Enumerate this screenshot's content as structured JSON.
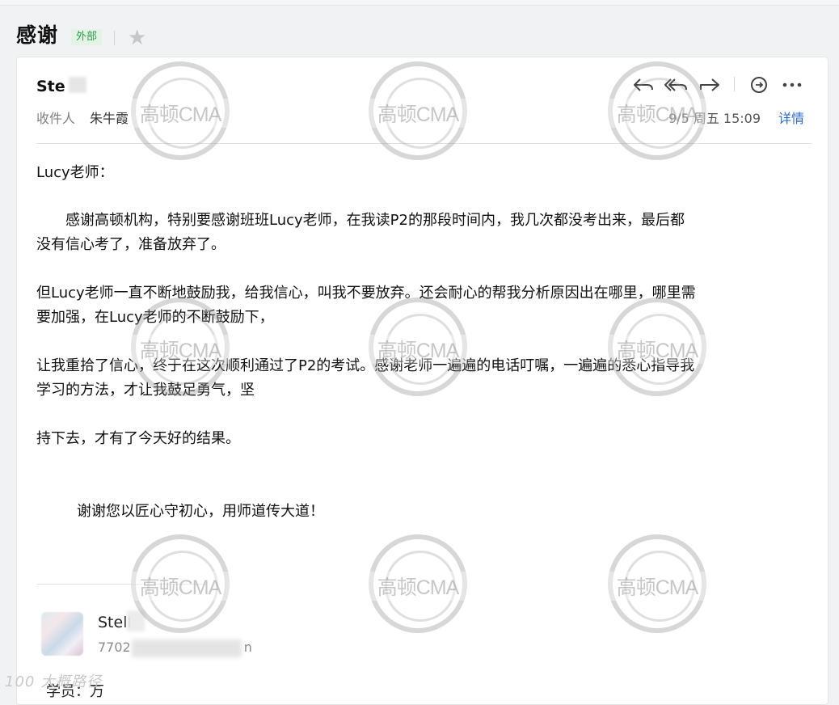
{
  "subject": "感谢",
  "external_badge": "外部",
  "email": {
    "sender": "Ste",
    "recipient_label": "收件人",
    "recipient": "朱牛霞",
    "date": "9/5 周五 15:09",
    "details_label": "详情"
  },
  "toolbar": {
    "icons": [
      "reply-icon",
      "reply-all-icon",
      "forward-icon",
      "comment-icon",
      "more-icon"
    ]
  },
  "body": {
    "greeting": "Lucy老师：",
    "para1": [
      "　　感谢高顿机构，特别要感谢班班Lucy老师，在我读P2的那段时间内，我几次都没考出来，最后都",
      "没有信心考了，准备放弃了。"
    ],
    "para2": [
      "但Lucy老师一直不断地鼓励我，给我信心，叫我不要放弃。还会耐心的帮我分析原因出在哪里，哪里需",
      "要加强，在Lucy老师的不断鼓励下，"
    ],
    "para3": [
      "让我重拾了信心，终于在这次顺利通过了P2的考试。感谢老师一遍遍的电话叮嘱，一遍遍的悉心指导我",
      "学习的方法，才让我鼓足勇气，坚"
    ],
    "para4": "持下去，才有了今天好的结果。",
    "closing": "谢谢您以匠心守初心，用师道传大道！"
  },
  "signature": {
    "name": "Stell",
    "email_prefix": "7702",
    "email_suffix": "n",
    "extra": "学员：万"
  },
  "watermark": {
    "text": "高顿CMA"
  },
  "bottom_logo": "100 大概路径"
}
